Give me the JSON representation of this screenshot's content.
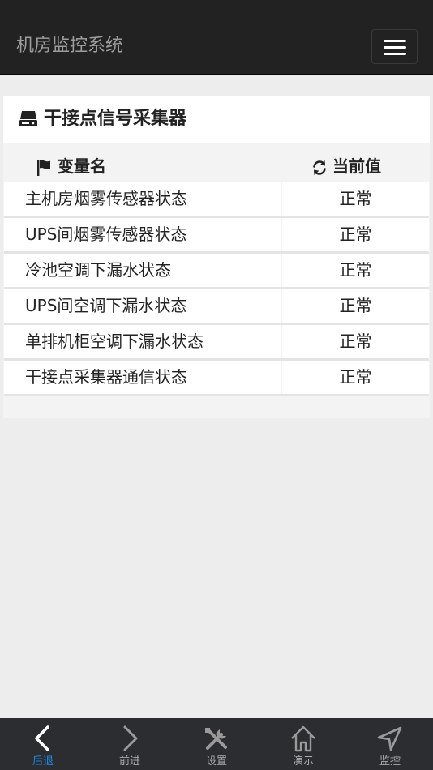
{
  "header": {
    "title": "机房监控系统",
    "menu_icon": "hamburger-menu-icon"
  },
  "panel": {
    "icon": "hard-drive-icon",
    "title": "干接点信号采集器",
    "columns": {
      "name": {
        "icon": "flag-icon",
        "label": "变量名"
      },
      "value": {
        "icon": "refresh-icon",
        "label": "当前值"
      }
    },
    "rows": [
      {
        "name": "主机房烟雾传感器状态",
        "value": "正常"
      },
      {
        "name": "UPS间烟雾传感器状态",
        "value": "正常"
      },
      {
        "name": "冷池空调下漏水状态",
        "value": "正常"
      },
      {
        "name": "UPS间空调下漏水状态",
        "value": "正常"
      },
      {
        "name": "单排机柜空调下漏水状态",
        "value": "正常"
      },
      {
        "name": "干接点采集器通信状态",
        "value": "正常"
      }
    ]
  },
  "tabbar": {
    "active_color": "#1e88e5",
    "items": [
      {
        "label": "后退",
        "icon": "chevron-left-icon",
        "active": true
      },
      {
        "label": "前进",
        "icon": "chevron-right-icon",
        "active": false
      },
      {
        "label": "设置",
        "icon": "tools-icon",
        "active": false
      },
      {
        "label": "演示",
        "icon": "home-icon",
        "active": false
      },
      {
        "label": "监控",
        "icon": "navigation-arrow-icon",
        "active": false
      }
    ]
  }
}
